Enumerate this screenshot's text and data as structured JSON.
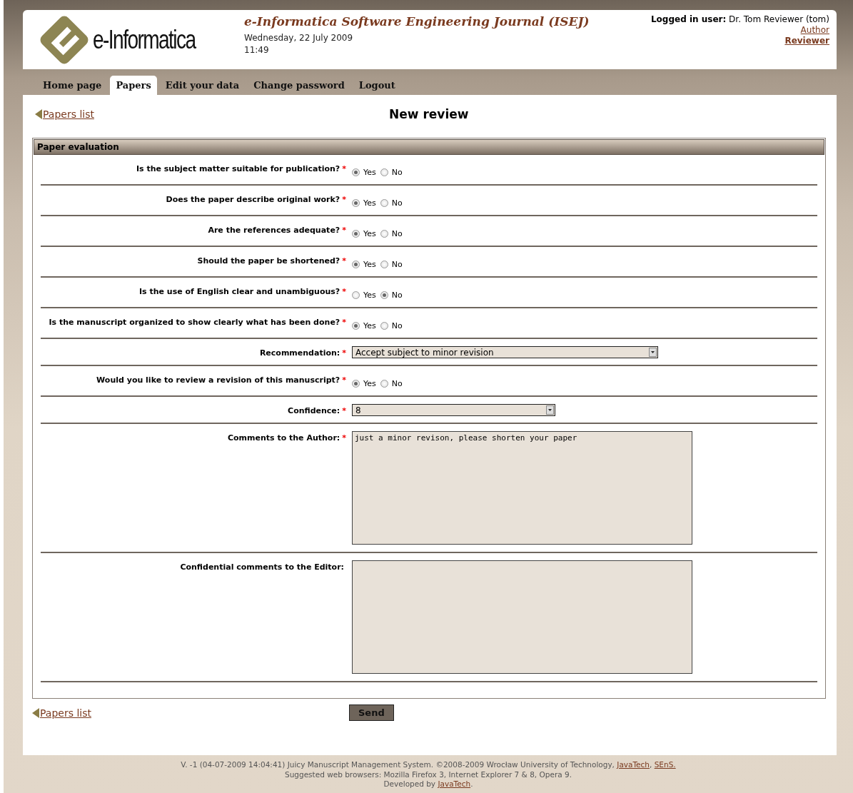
{
  "header": {
    "logo_text": "e-Informatica",
    "journal_title": "e-Informatica Software Engineering Journal (ISEJ)",
    "date": "Wednesday, 22 July 2009",
    "time": "11:49",
    "user_label": "Logged in user:",
    "user_name": "Dr. Tom Reviewer (tom)",
    "roles": [
      {
        "label": "Author",
        "selected": false
      },
      {
        "label": "Reviewer",
        "selected": true
      }
    ]
  },
  "tabs": [
    {
      "label": "Home page",
      "selected": false
    },
    {
      "label": "Papers",
      "selected": true
    },
    {
      "label": "Edit your data",
      "selected": false
    },
    {
      "label": "Change password",
      "selected": false
    },
    {
      "label": "Logout",
      "selected": false
    }
  ],
  "back_link": "Papers list",
  "page_title": "New review",
  "section": {
    "title": "Paper evaluation",
    "rows": [
      {
        "kind": "radio",
        "label": "Is the subject matter suitable for publication?",
        "required_mark": "*",
        "options": [
          {
            "label": "Yes",
            "selected": true
          },
          {
            "label": "No",
            "selected": false
          }
        ]
      },
      {
        "kind": "radio",
        "label": "Does the paper describe original work?",
        "required_mark": "*",
        "options": [
          {
            "label": "Yes",
            "selected": true
          },
          {
            "label": "No",
            "selected": false
          }
        ]
      },
      {
        "kind": "radio",
        "label": "Are the references adequate?",
        "required_mark": "*",
        "options": [
          {
            "label": "Yes",
            "selected": true
          },
          {
            "label": "No",
            "selected": false
          }
        ]
      },
      {
        "kind": "radio",
        "label": "Should the paper be shortened?",
        "required_mark": "*",
        "options": [
          {
            "label": "Yes",
            "selected": true
          },
          {
            "label": "No",
            "selected": false
          }
        ]
      },
      {
        "kind": "radio",
        "label": "Is the use of English clear and unambiguous?",
        "required_mark": "*",
        "options": [
          {
            "label": "Yes",
            "selected": false
          },
          {
            "label": "No",
            "selected": true
          }
        ]
      },
      {
        "kind": "radio",
        "label": "Is the manuscript organized to show clearly what has been done?",
        "required_mark": "*",
        "options": [
          {
            "label": "Yes",
            "selected": true
          },
          {
            "label": "No",
            "selected": false
          }
        ]
      },
      {
        "kind": "select",
        "label": "Recommendation:",
        "required_mark": "*",
        "value": "Accept subject to minor revision"
      },
      {
        "kind": "radio",
        "label": "Would you like to review a revision of this manuscript?",
        "required_mark": "*",
        "options": [
          {
            "label": "Yes",
            "selected": true
          },
          {
            "label": "No",
            "selected": false
          }
        ]
      },
      {
        "kind": "select",
        "label": "Confidence:",
        "required_mark": "*",
        "value": "8"
      },
      {
        "kind": "textarea",
        "label": "Comments to the Author:",
        "required_mark": "*",
        "value": "just a minor revison, please shorten your paper"
      },
      {
        "kind": "textarea",
        "label": "Confidential comments to the Editor:"
      }
    ]
  },
  "bottom_link": "Papers list",
  "send_button": "Send",
  "footer": [
    [
      {
        "kind": "text",
        "text": "V. -1 (04-07-2009 14:04:41) Juicy Manuscript Management System. ©2008-2009 Wrocław University of Technology, "
      },
      {
        "kind": "link",
        "text": "JavaTech"
      },
      {
        "kind": "text",
        "text": ", "
      },
      {
        "kind": "link",
        "text": "SEnS."
      }
    ],
    [
      {
        "kind": "text",
        "text": "Suggested web browsers: Mozilla Firefox 3, Internet Explorer 7 & 8, Opera 9."
      }
    ],
    [
      {
        "kind": "text",
        "text": "Developed by "
      },
      {
        "kind": "link",
        "text": "JavaTech"
      },
      {
        "kind": "text",
        "text": "."
      }
    ]
  ]
}
